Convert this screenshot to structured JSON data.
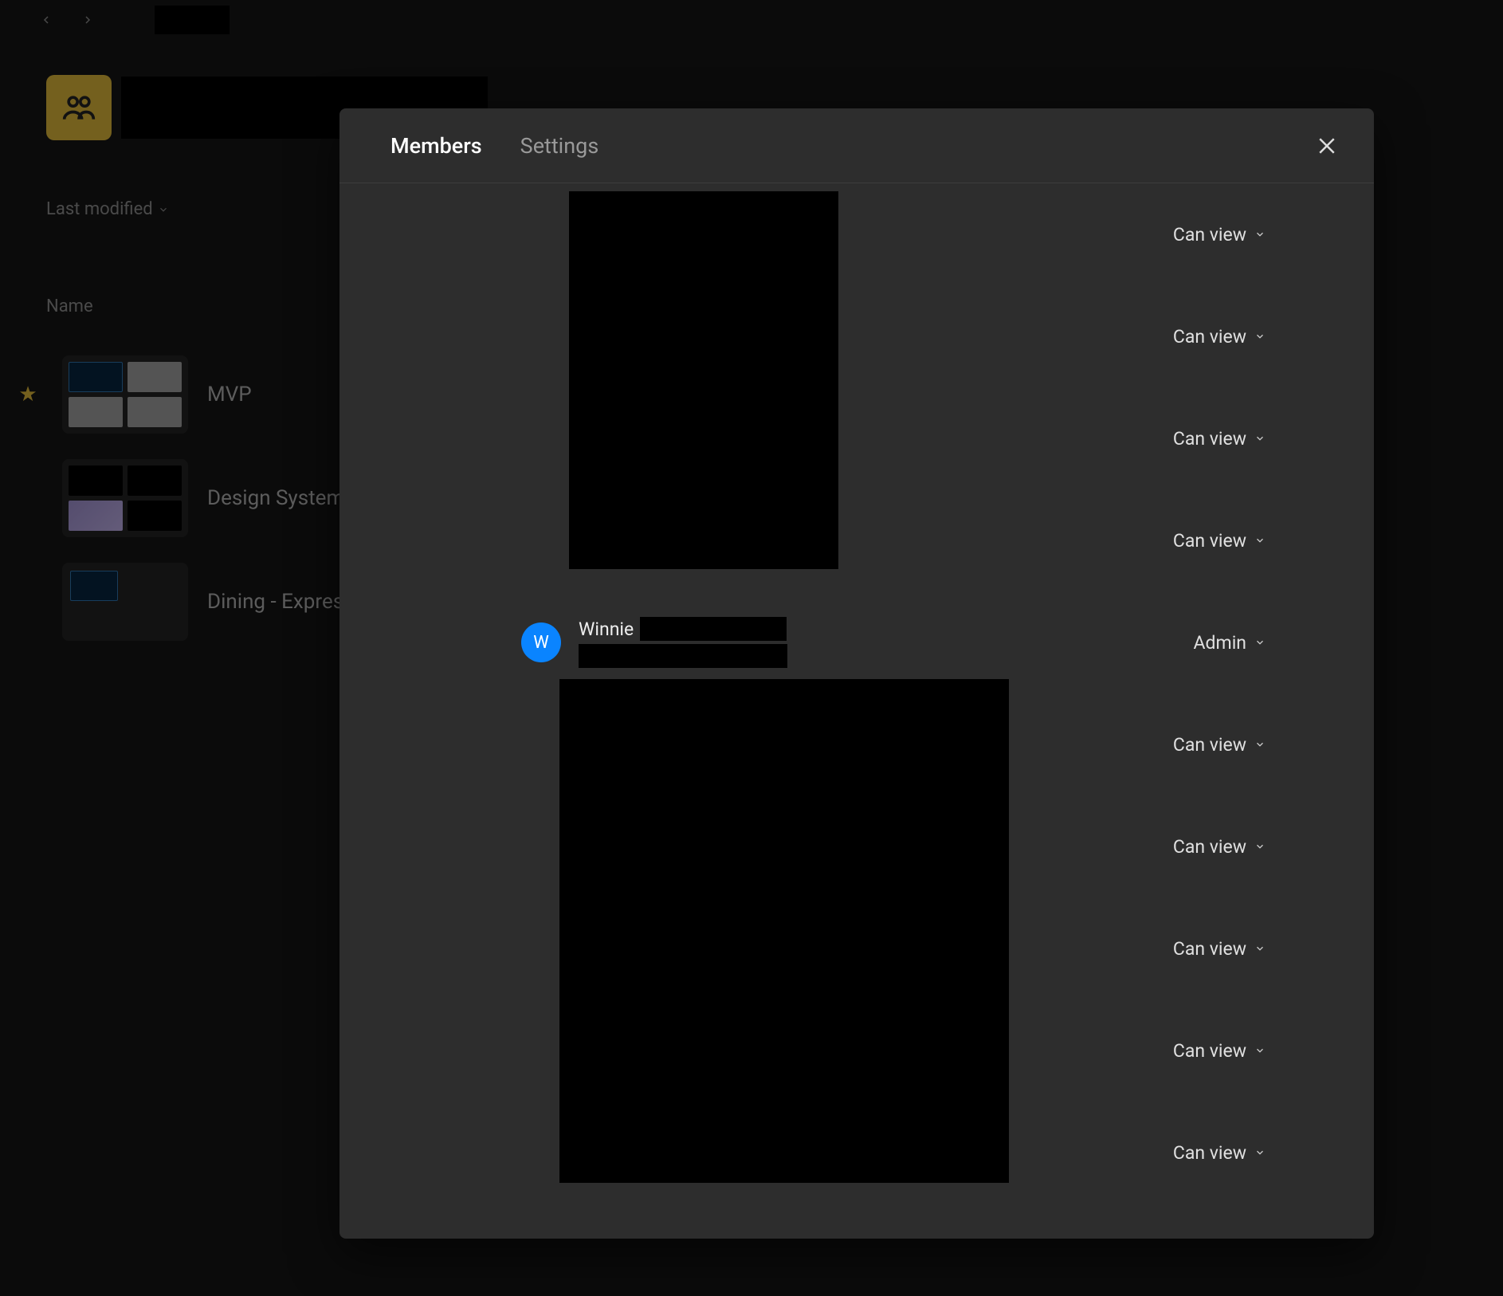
{
  "topbar": {
    "back": "‹",
    "forward": "›"
  },
  "team": {
    "icon": "people-icon"
  },
  "sort": {
    "label": "Last modified"
  },
  "columns": {
    "name": "Name"
  },
  "files": [
    {
      "name": "MVP",
      "starred": true,
      "thumb": "grid-a"
    },
    {
      "name": "Design System",
      "starred": false,
      "thumb": "grid-b"
    },
    {
      "name": "Dining - Express",
      "starred": false,
      "thumb": "single"
    }
  ],
  "modal": {
    "tabs": {
      "members": "Members",
      "settings": "Settings"
    },
    "roles": {
      "can_view": "Can view",
      "admin": "Admin"
    },
    "members": [
      {
        "name": "",
        "email": "",
        "role": "can_view",
        "avatar": ""
      },
      {
        "name": "",
        "email": "",
        "role": "can_view",
        "avatar": ""
      },
      {
        "name": "",
        "email": "",
        "role": "can_view",
        "avatar": ""
      },
      {
        "name": "",
        "email": "",
        "role": "can_view",
        "avatar": ""
      },
      {
        "name": "Winnie",
        "email": "",
        "role": "admin",
        "avatar": "W"
      },
      {
        "name": "",
        "email": "",
        "role": "can_view",
        "avatar": ""
      },
      {
        "name": "",
        "email": "",
        "role": "can_view",
        "avatar": ""
      },
      {
        "name": "",
        "email": "",
        "role": "can_view",
        "avatar": ""
      },
      {
        "name": "",
        "email": "",
        "role": "can_view",
        "avatar": ""
      },
      {
        "name": "",
        "email": "",
        "role": "can_view",
        "avatar": ""
      }
    ]
  }
}
